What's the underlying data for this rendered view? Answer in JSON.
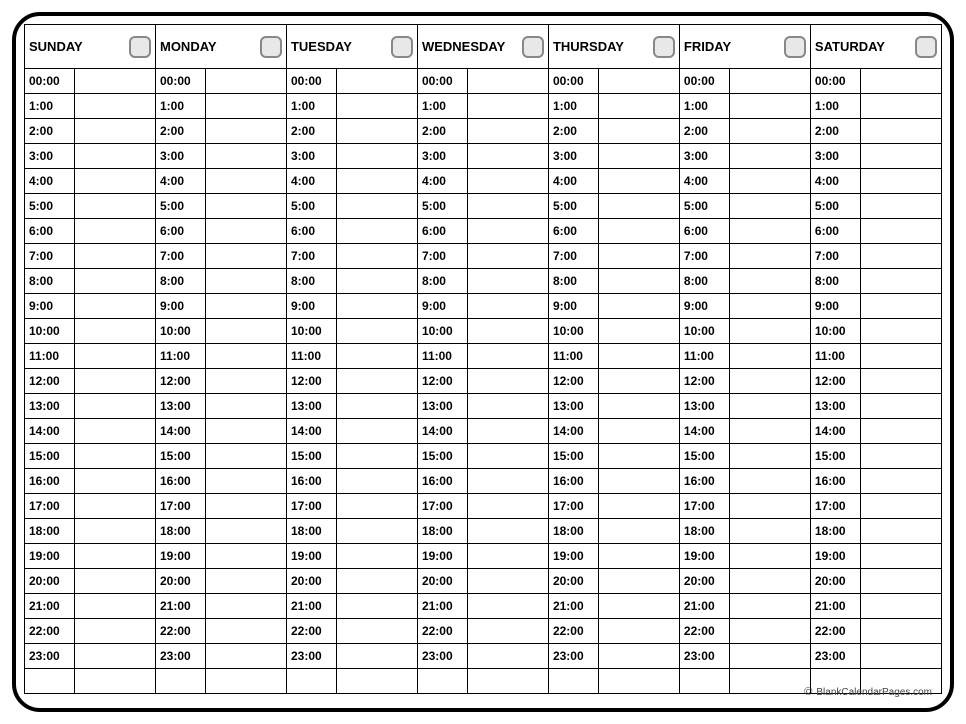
{
  "days": [
    "SUNDAY",
    "MONDAY",
    "TUESDAY",
    "WEDNESDAY",
    "THURSDAY",
    "FRIDAY",
    "SATURDAY"
  ],
  "hours": [
    "00:00",
    "1:00",
    "2:00",
    "3:00",
    "4:00",
    "5:00",
    "6:00",
    "7:00",
    "8:00",
    "9:00",
    "10:00",
    "11:00",
    "12:00",
    "13:00",
    "14:00",
    "15:00",
    "16:00",
    "17:00",
    "18:00",
    "19:00",
    "20:00",
    "21:00",
    "22:00",
    "23:00"
  ],
  "footer": {
    "copyright": "©",
    "site": "BlankCalendarPages.com"
  }
}
